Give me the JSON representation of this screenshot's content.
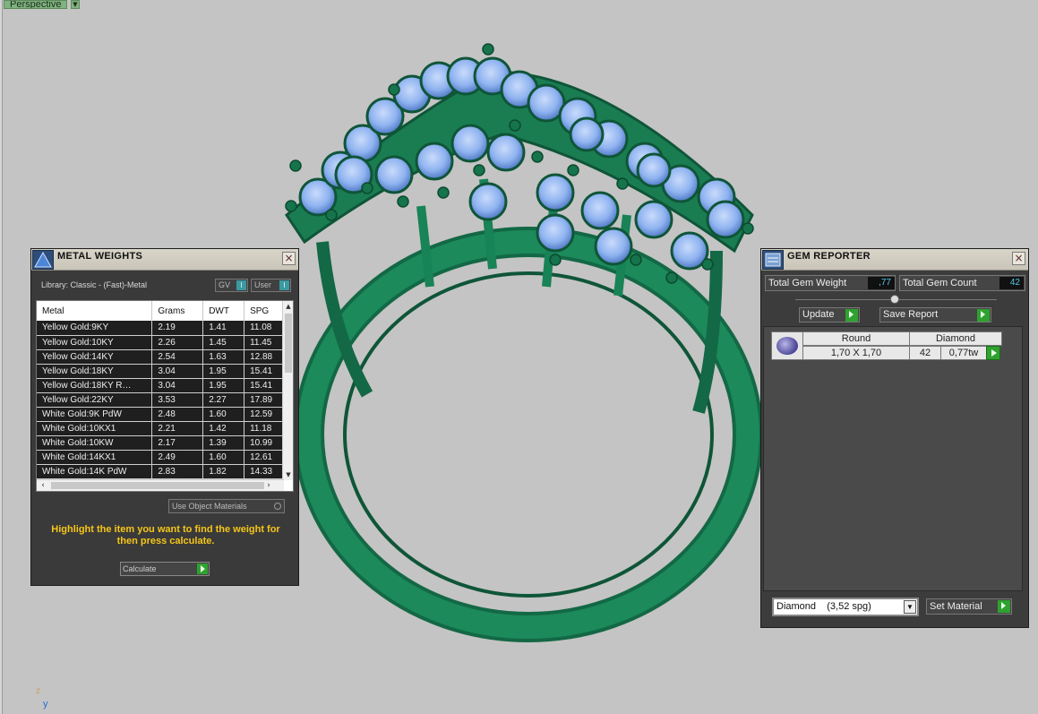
{
  "viewport": {
    "label": "Perspective",
    "axis_z": "z",
    "axis_y": "y"
  },
  "metal_weights": {
    "title": "METAL WEIGHTS",
    "library": "Library: Classic - (Fast)-Metal",
    "gv_label": "GV",
    "user_label": "User",
    "columns": [
      "Metal",
      "Grams",
      "DWT",
      "SPG"
    ],
    "rows": [
      {
        "metal": "Yellow Gold:9KY",
        "grams": "2.19",
        "dwt": "1.41",
        "spg": "11.08"
      },
      {
        "metal": "Yellow Gold:10KY",
        "grams": "2.26",
        "dwt": "1.45",
        "spg": "11.45"
      },
      {
        "metal": "Yellow Gold:14KY",
        "grams": "2.54",
        "dwt": "1.63",
        "spg": "12.88"
      },
      {
        "metal": "Yellow Gold:18KY",
        "grams": "3.04",
        "dwt": "1.95",
        "spg": "15.41"
      },
      {
        "metal": "Yellow Gold:18KY R…",
        "grams": "3.04",
        "dwt": "1.95",
        "spg": "15.41"
      },
      {
        "metal": "Yellow Gold:22KY",
        "grams": "3.53",
        "dwt": "2.27",
        "spg": "17.89"
      },
      {
        "metal": "White Gold:9K PdW",
        "grams": "2.48",
        "dwt": "1.60",
        "spg": "12.59"
      },
      {
        "metal": "White Gold:10KX1",
        "grams": "2.21",
        "dwt": "1.42",
        "spg": "11.18"
      },
      {
        "metal": "White Gold:10KW",
        "grams": "2.17",
        "dwt": "1.39",
        "spg": "10.99"
      },
      {
        "metal": "White Gold:14KX1",
        "grams": "2.49",
        "dwt": "1.60",
        "spg": "12.61"
      },
      {
        "metal": "White Gold:14K PdW",
        "grams": "2.83",
        "dwt": "1.82",
        "spg": "14.33"
      }
    ],
    "use_object_materials": "Use Object Materials",
    "hint": "Highlight the item you want to find the weight for then press calculate.",
    "calculate_label": "Calculate"
  },
  "gem_reporter": {
    "title": "GEM REPORTER",
    "total_weight_label": "Total Gem Weight",
    "total_weight_value": ",77",
    "total_count_label": "Total Gem Count",
    "total_count_value": "42",
    "update_label": "Update",
    "save_report_label": "Save Report",
    "gem": {
      "shape": "Round",
      "type": "Diamond",
      "size": "1,70 X 1,70",
      "count": "42",
      "weight": "0,77tw"
    },
    "material_selected": "Diamond    (3,52 spg)",
    "set_material_label": "Set Material"
  },
  "colors": {
    "metal": "#1c8a5a",
    "gem": "#8fb3f0",
    "accent_green": "#2fa12f",
    "hint_yellow": "#f5c518",
    "value_cyan": "#52c8e8"
  }
}
